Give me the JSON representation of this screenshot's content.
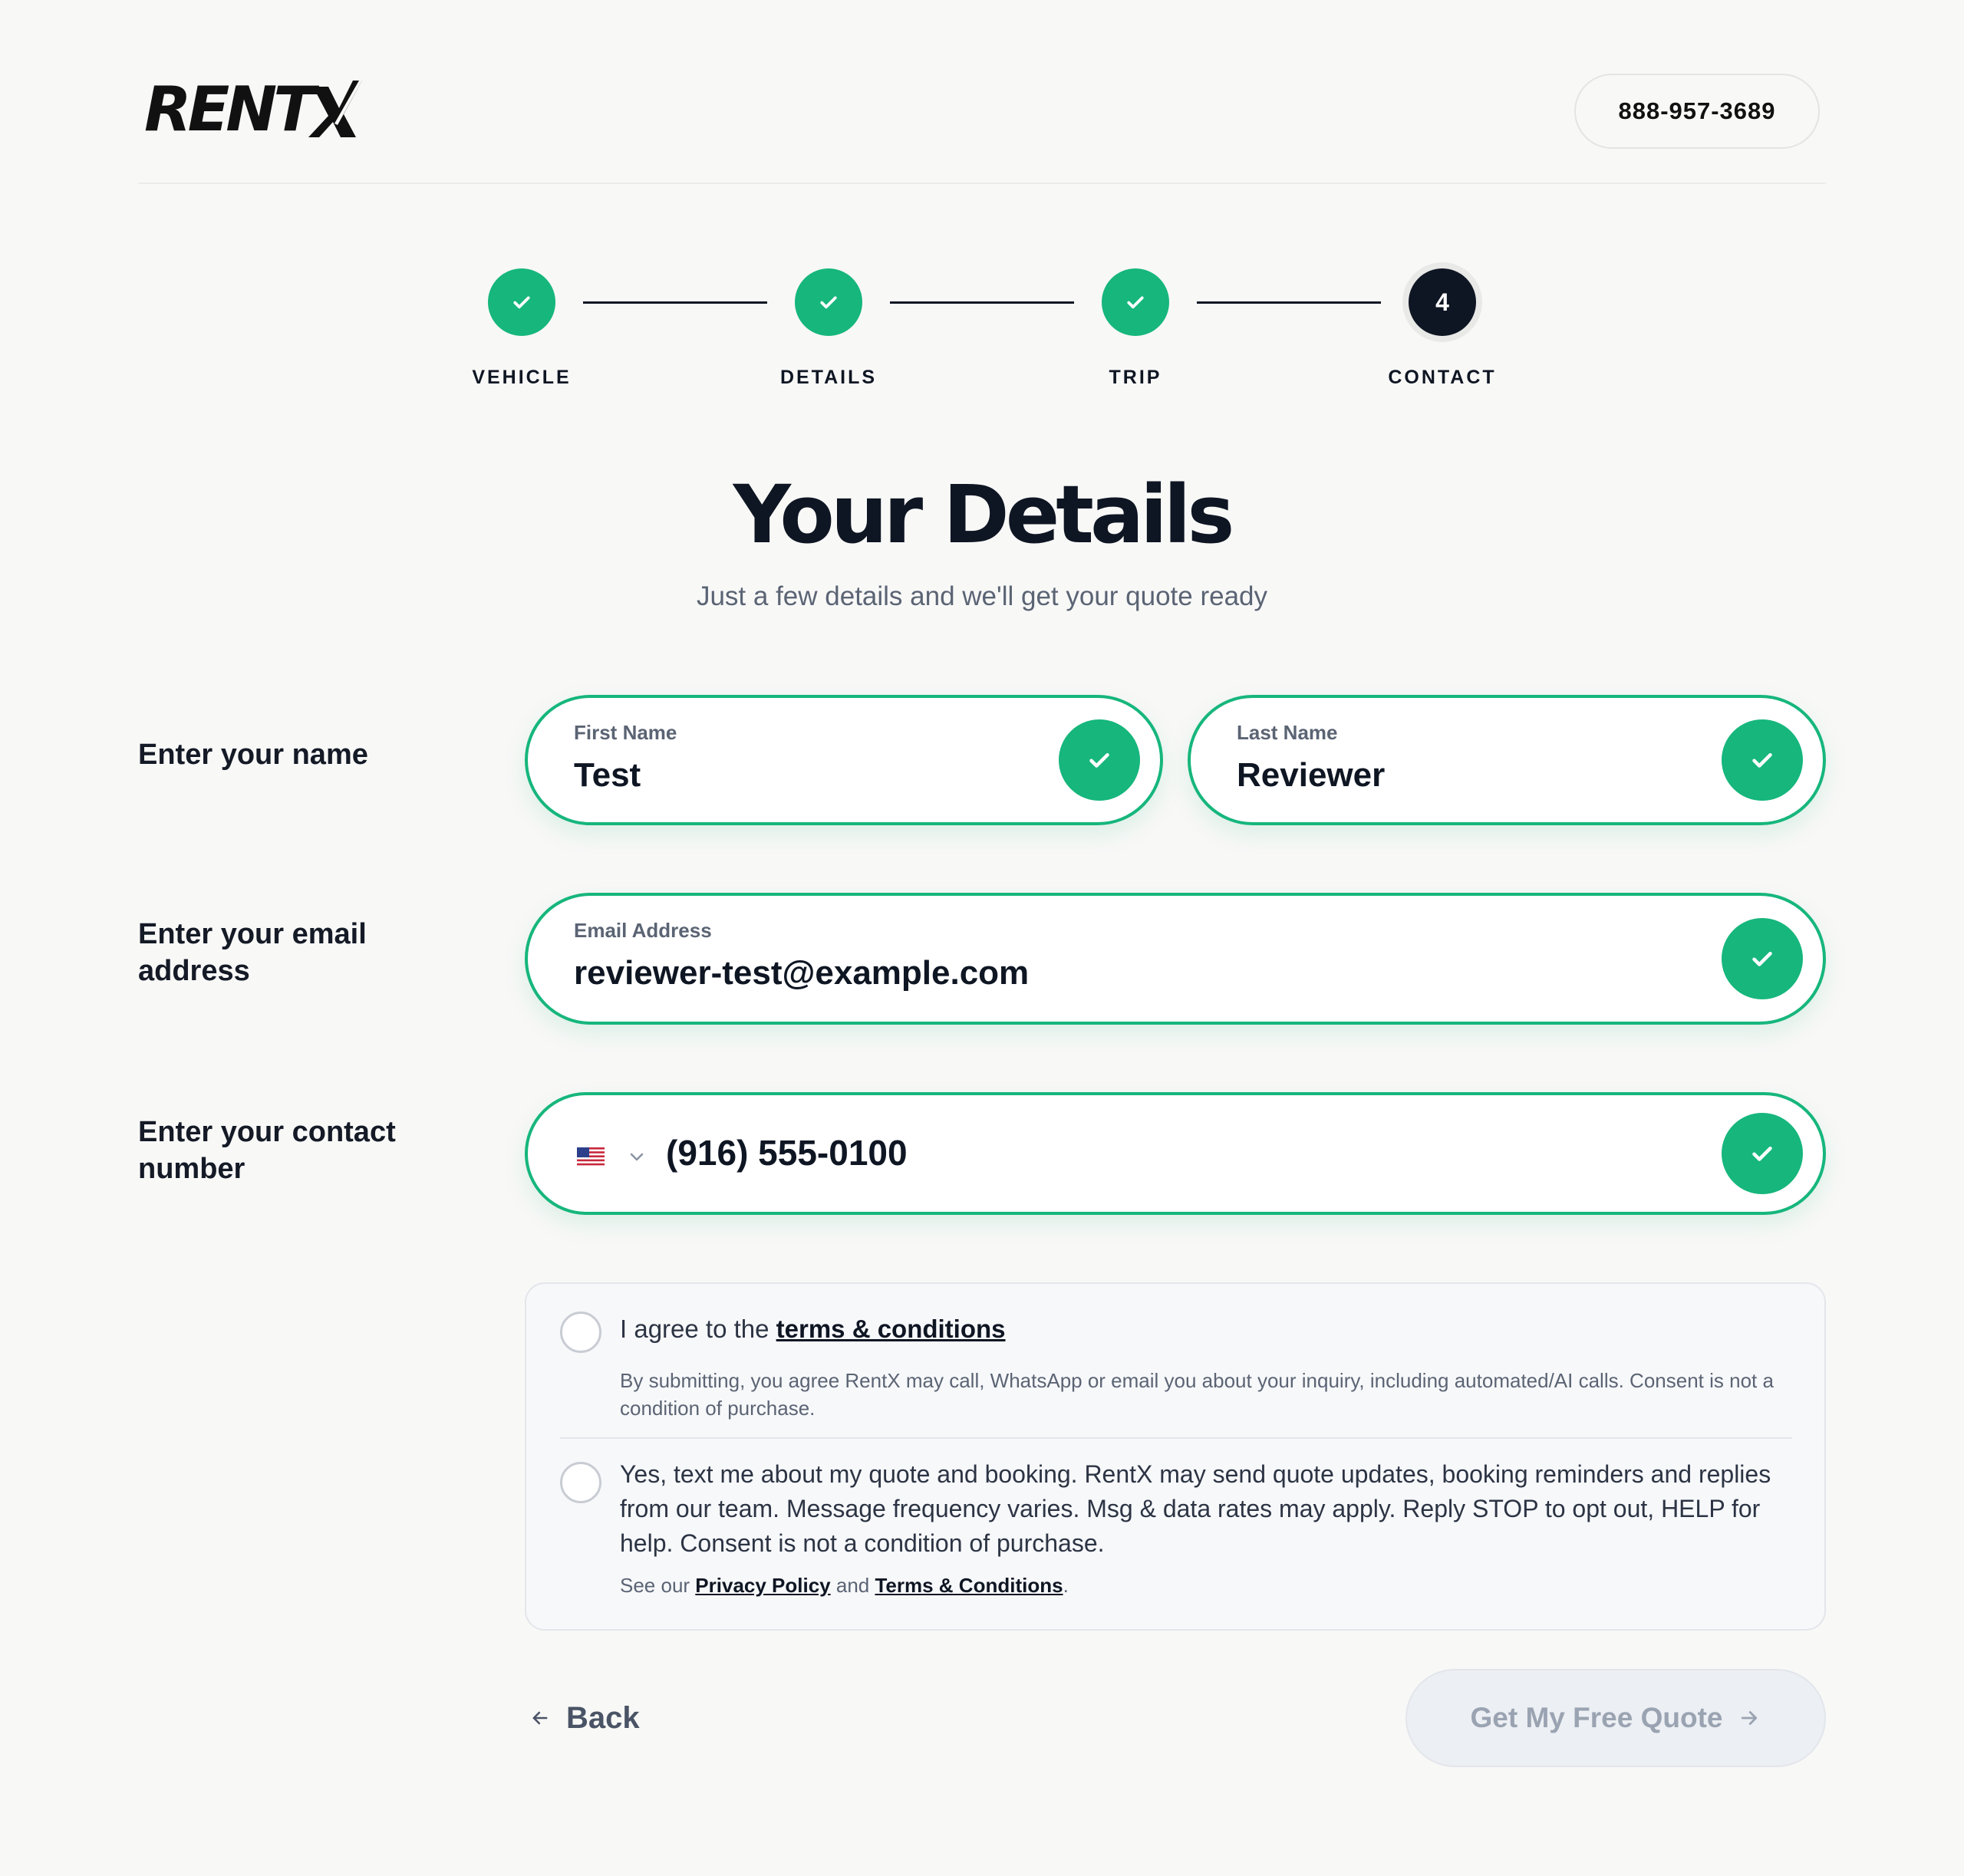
{
  "header": {
    "logo_text": "RENTX",
    "phone": "888-957-3689"
  },
  "stepper": {
    "steps": [
      {
        "label": "VEHICLE",
        "status": "complete"
      },
      {
        "label": "DETAILS",
        "status": "complete"
      },
      {
        "label": "TRIP",
        "status": "complete"
      },
      {
        "label": "CONTACT",
        "status": "current",
        "number": "4"
      }
    ]
  },
  "page": {
    "title": "Your Details",
    "subtitle": "Just a few details and we'll get your quote ready"
  },
  "form": {
    "name_row_label": "Enter your name",
    "first_name": {
      "label": "First Name",
      "value": "Test"
    },
    "last_name": {
      "label": "Last Name",
      "value": "Reviewer"
    },
    "email_row_label": "Enter your email address",
    "email": {
      "label": "Email Address",
      "value": "reviewer-test@example.com"
    },
    "phone_row_label": "Enter your contact number",
    "phone": {
      "value": "(916) 555-0100",
      "country_icon": "us-flag-icon"
    }
  },
  "consent": {
    "terms_prefix": "I agree to the ",
    "terms_link": "terms & conditions",
    "terms_note": "By submitting, you agree RentX may call, WhatsApp or email you about your inquiry, including automated/AI calls. Consent is not a condition of purchase.",
    "sms_text": "Yes, text me about my quote and booking. RentX may send quote updates, booking reminders and replies from our team. Message frequency varies. Msg & data rates may apply. Reply STOP to opt out, HELP for help. Consent is not a condition of purchase.",
    "see_prefix": "See our ",
    "privacy_link": "Privacy Policy",
    "and_text": " and ",
    "tc_link": "Terms & Conditions",
    "see_suffix": "."
  },
  "actions": {
    "back_label": "Back",
    "submit_label": "Get My Free Quote"
  },
  "colors": {
    "accent": "#16b67c",
    "dark": "#0f1623",
    "background": "#f8f8f7"
  }
}
